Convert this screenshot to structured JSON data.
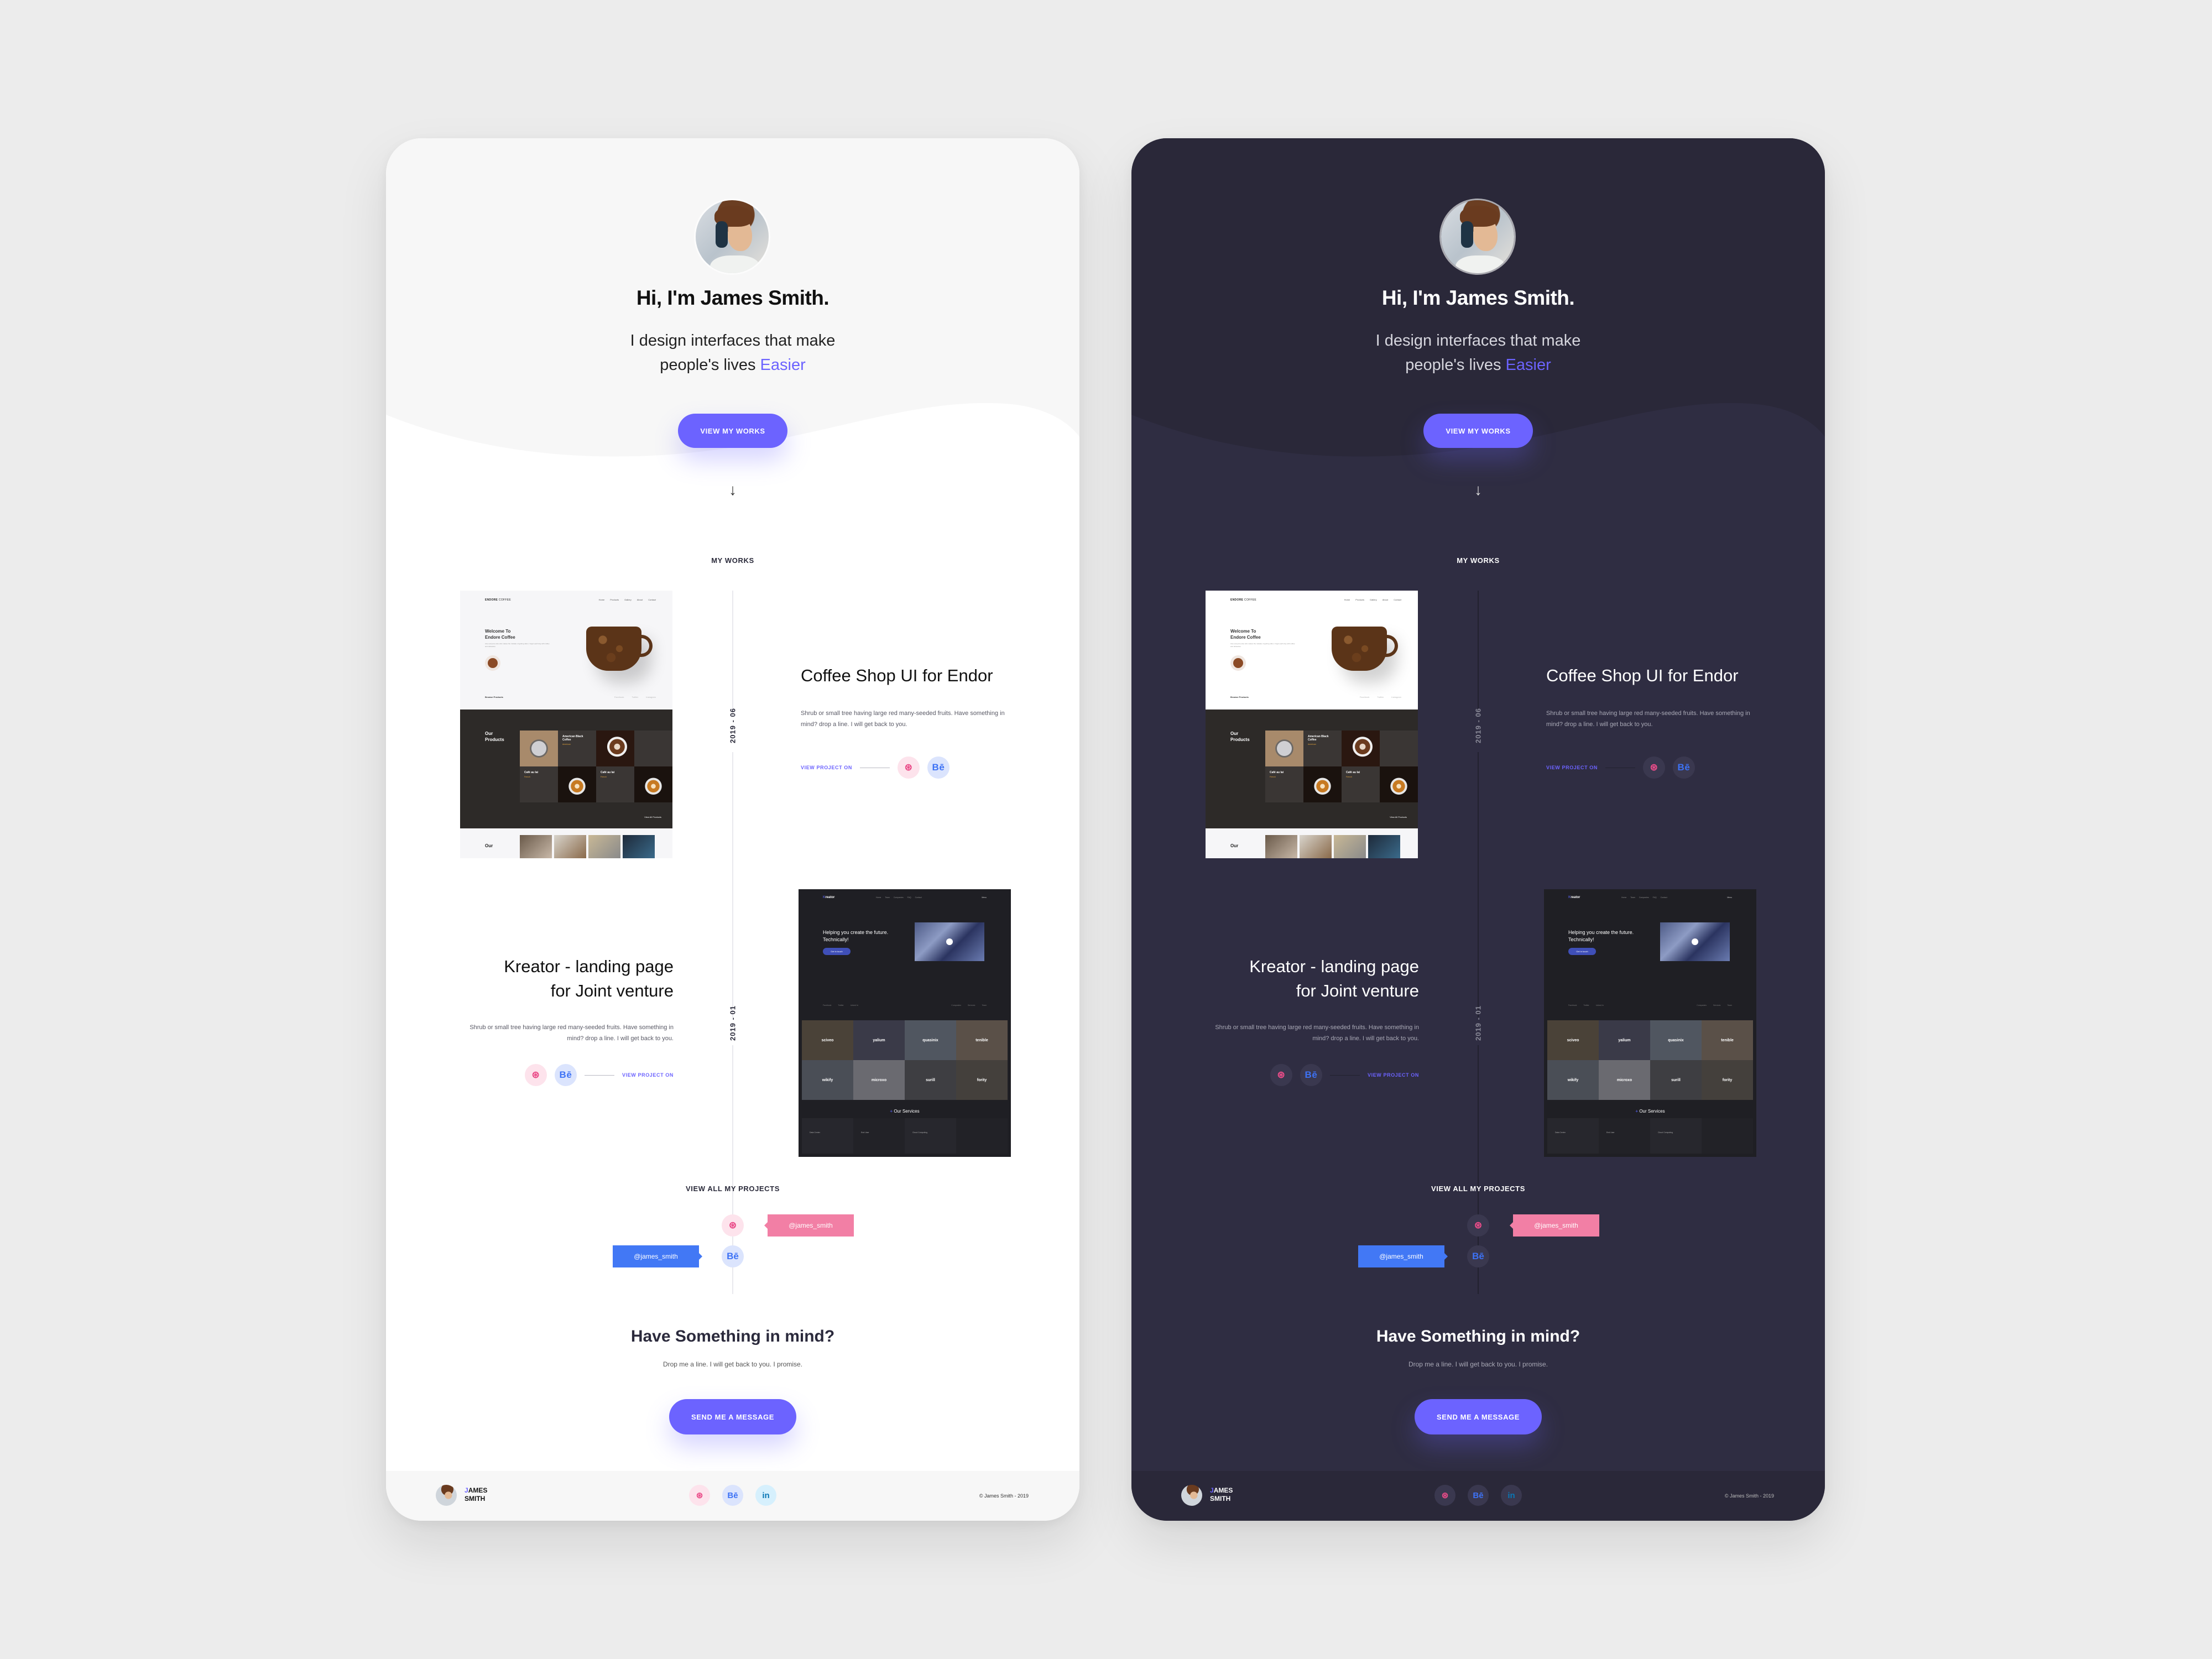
{
  "theme_colors": {
    "accent": "#6c63ff",
    "light_background": "#ffffff",
    "dark_background": "#2f2d42",
    "page_background": "#ececec",
    "dribbble": "#ea4c89",
    "behance": "#3d72f5",
    "linkedin": "#0a77b5",
    "tag_pink": "#f27fa5",
    "tag_blue": "#4278f5"
  },
  "variants": [
    "light",
    "dark"
  ],
  "hero": {
    "avatar_icon": "profile-photo",
    "title": "Hi, I'm James Smith.",
    "subtitle_line1": "I design interfaces that make",
    "subtitle_line2": "people's lives",
    "subtitle_accent": "Easier",
    "cta_label": "View my works",
    "scroll_icon": "↓"
  },
  "works": {
    "section_label": "MY WORKS",
    "projects": [
      {
        "date": "2019 - 06",
        "title": "Coffee Shop UI for Endor",
        "description": "Shrub or small tree having large red many-seeded fruits. Have something in mind? drop a line. I will get back to you.",
        "view_label": "VIEW PROJECT ON",
        "mockup": {
          "logo_bold": "ENDORE",
          "logo_rest": "COFFEE",
          "nav": [
            "Home",
            "Products",
            "Gallery",
            "About",
            "Contact"
          ],
          "hero_line1": "Welcome To",
          "hero_line2": "Endore Coffee",
          "hero_text": "Like everyone else who makes the mistake of getting older, I begin each day with coffee and obituaries",
          "browse": "Browse Products",
          "social": [
            "Facebook",
            "Twitter",
            "Instagram"
          ],
          "products_line1": "Our",
          "products_line2": "Products",
          "items": [
            {
              "title": "American Black Coffee",
              "sub": "American"
            },
            {
              "title": "Café au lai",
              "sub": "French"
            },
            {
              "title": "Café au lai",
              "sub": "French"
            }
          ],
          "view_all": "View All Products",
          "bottom_label": "Our"
        }
      },
      {
        "date": "2019 - 01",
        "title_line1": "Kreator - landing page",
        "title_line2": "for Joint venture",
        "description": "Shrub or small tree having large red many-seeded fruits. Have something in mind? drop a line. I will get back to you.",
        "view_label": "VIEW PROJECT ON",
        "mockup": {
          "logo_k": "K",
          "logo_rest": "reator",
          "nav": [
            "Home",
            "Team",
            "Companies",
            "FAQ",
            "Contact"
          ],
          "menu": "Menu",
          "headline": "Helping you create the future. Technically!",
          "cta": "Get in touch",
          "links_left": [
            "Facebook",
            "Twitter",
            "Linked In"
          ],
          "links_right": [
            "Companies",
            "Services",
            "Team"
          ],
          "companies": [
            "sciveo",
            "yalium",
            "quasinix",
            "tenible",
            "wikify",
            "microxo",
            "surill",
            "fority"
          ],
          "services_title": "Our Services",
          "services": [
            "Data Center",
            "End User",
            "Cloud Computing"
          ]
        }
      }
    ]
  },
  "view_all": {
    "label": "VIEW ALL MY PROJECTS",
    "dribbble_handle": "@james_smith",
    "behance_handle": "@james_smith"
  },
  "contact": {
    "title": "Have Something in mind?",
    "subtitle": "Drop me a line. I will get back to you. I promise.",
    "cta_label": "Send me a message"
  },
  "footer": {
    "name_initial": "J",
    "name_rest_line1": "AMES",
    "name_line2": "SMITH",
    "copyright": "© James Smith - 2019",
    "icons": {
      "dribbble": "⊛",
      "behance": "Bē",
      "linkedin": "in"
    }
  }
}
